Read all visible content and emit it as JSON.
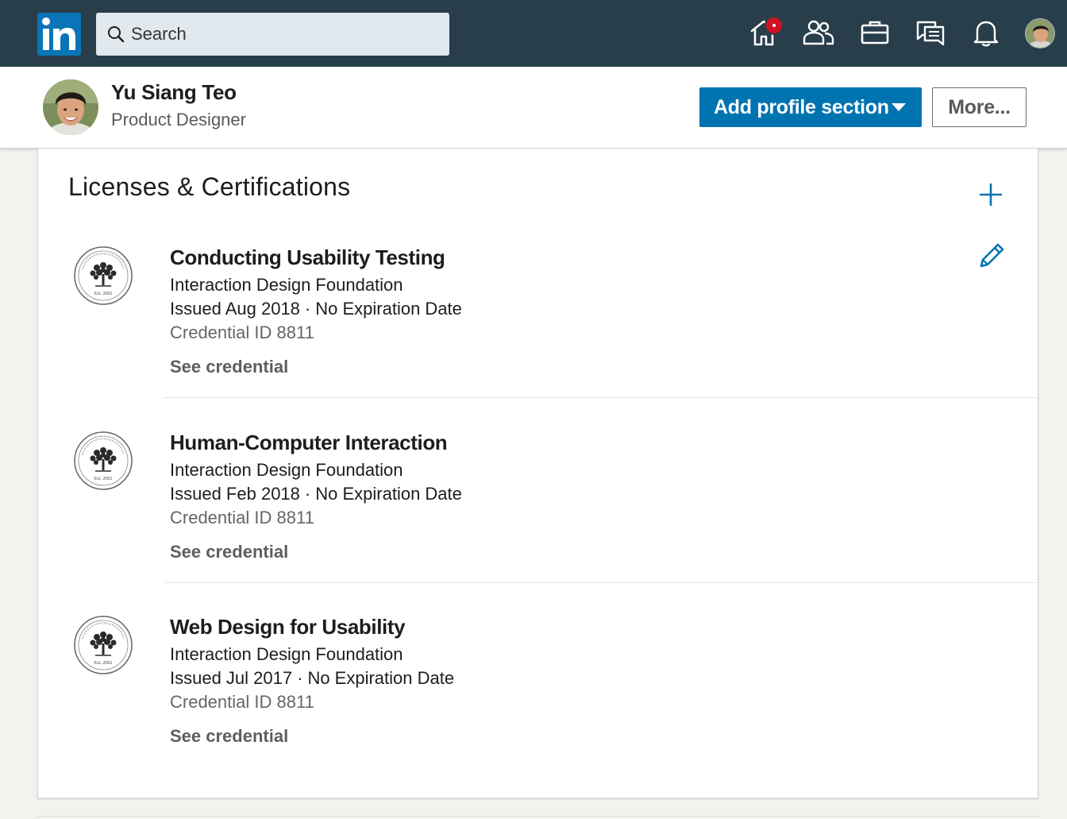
{
  "nav": {
    "logo_text": "in",
    "search_placeholder": "Search",
    "icons": [
      "home-icon",
      "network-icon",
      "jobs-icon",
      "messaging-icon",
      "notifications-icon"
    ],
    "colors": {
      "bar": "#283e4a",
      "logo": "#0a74b8",
      "badge": "#d11124"
    }
  },
  "profile": {
    "name": "Yu Siang Teo",
    "headline": "Product Designer",
    "add_section_label": "Add profile section",
    "more_label": "More..."
  },
  "section": {
    "title": "Licenses & Certifications",
    "items": [
      {
        "title": "Conducting Usability Testing",
        "org": "Interaction Design Foundation",
        "issued": "Issued Aug 2018",
        "separator": "·",
        "expiry": "No Expiration Date",
        "credential_id": "Credential ID 8811",
        "link": "See credential",
        "logo_text": "Est. 2002"
      },
      {
        "title": "Human-Computer Interaction",
        "org": "Interaction Design Foundation",
        "issued": "Issued Feb 2018",
        "separator": "·",
        "expiry": "No Expiration Date",
        "credential_id": "Credential ID 8811",
        "link": "See credential",
        "logo_text": "Est. 2002"
      },
      {
        "title": "Web Design for Usability",
        "org": "Interaction Design Foundation",
        "issued": "Issued Jul 2017",
        "separator": "·",
        "expiry": "No Expiration Date",
        "credential_id": "Credential ID 8811",
        "link": "See credential",
        "logo_text": "Est. 2002"
      }
    ]
  },
  "colors": {
    "primary": "#0073b1",
    "text": "#1d1d1d",
    "muted": "#666666"
  }
}
